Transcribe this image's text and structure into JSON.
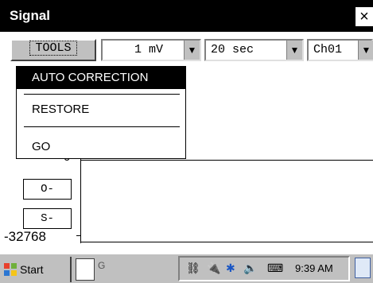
{
  "window": {
    "title": "Signal",
    "close_label": "×"
  },
  "toolbar": {
    "tools_label": "TOOLS",
    "scale_value": "1 mV",
    "time_value": "20 sec",
    "channel_value": "Ch01"
  },
  "menu": {
    "items": [
      {
        "label": "AUTO CORRECTION",
        "selected": true
      },
      {
        "label": "RESTORE",
        "selected": false
      },
      {
        "label": "GO",
        "selected": false
      }
    ]
  },
  "plot": {
    "y_top_label": "0",
    "y_bottom_label": "-32768",
    "offset_button": "O-",
    "scale_button": "S-"
  },
  "taskbar": {
    "start_label": "Start",
    "task_label": "G",
    "clock": "9:39 AM",
    "tray_icons": [
      "network-icon",
      "power-icon",
      "bluetooth-icon",
      "volume-icon",
      "input-icon"
    ]
  },
  "colors": {
    "titlebar": "#000000",
    "menu_highlight": "#000000",
    "taskbar": "#c0c0c0"
  }
}
